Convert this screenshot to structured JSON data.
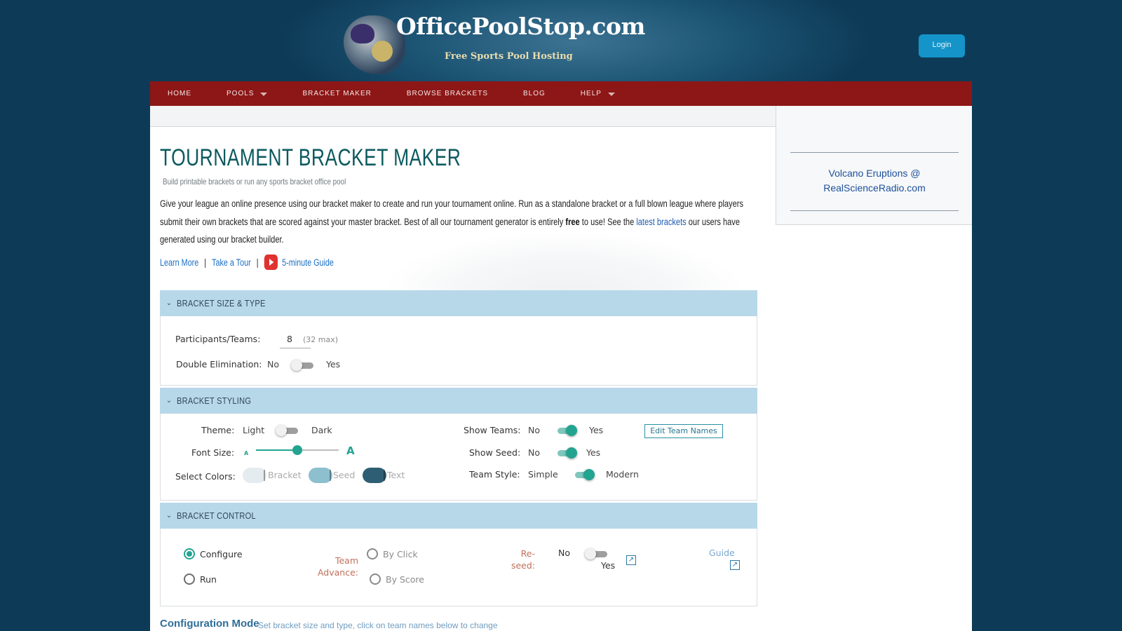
{
  "header": {
    "logo_title": "OfficePoolStop.com",
    "logo_tagline": "Free Sports Pool Hosting",
    "login_label": "Login"
  },
  "nav": {
    "items": [
      {
        "label": "HOME",
        "dropdown": false
      },
      {
        "label": "POOLS",
        "dropdown": true
      },
      {
        "label": "BRACKET MAKER",
        "dropdown": false
      },
      {
        "label": "BROWSE BRACKETS",
        "dropdown": false
      },
      {
        "label": "BLOG",
        "dropdown": false
      },
      {
        "label": "HELP",
        "dropdown": true
      }
    ]
  },
  "page": {
    "title": "TOURNAMENT BRACKET MAKER",
    "subtitle": "Build printable brackets or run any sports bracket office pool",
    "intro_part1": "Give your league an online presence using our bracket maker to create and run your tournament online. Run as a standalone bracket or a full blown league where players submit their own brackets that are scored against your master bracket. Best of all our tournament generator is entirely ",
    "intro_bold": "free",
    "intro_part2": " to use! See the ",
    "intro_link": "latest brackets",
    "intro_part3": " our users have generated using our bracket builder.",
    "link_learn_more": "Learn More",
    "link_take_tour": "Take a Tour",
    "link_guide": "5-minute Guide",
    "link_separator": "|"
  },
  "sidebar": {
    "link_line1": "Volcano Eruptions @",
    "link_line2": "RealScienceRadio.com"
  },
  "panel_size": {
    "title": "BRACKET SIZE & TYPE",
    "participants_label": "Participants/Teams:",
    "participants_value": "8",
    "participants_hint": "(32 max)",
    "double_elim_label": "Double Elimination:",
    "double_elim_no": "No",
    "double_elim_yes": "Yes",
    "double_elim_on": false
  },
  "panel_styling": {
    "title": "BRACKET STYLING",
    "theme_label": "Theme:",
    "theme_light": "Light",
    "theme_dark": "Dark",
    "theme_dark_on": false,
    "font_size_label": "Font Size:",
    "font_small": "A",
    "font_large": "A",
    "font_size_fraction": 0.5,
    "colors_label": "Select Colors:",
    "color_bracket_label": "Bracket",
    "color_seed_label": "Seed",
    "color_text_label": "Text",
    "color_bracket": "#e5ecef",
    "color_seed": "#8dbfcf",
    "color_text": "#2e5e73",
    "show_teams_label": "Show Teams:",
    "show_teams_no": "No",
    "show_teams_yes": "Yes",
    "show_teams_on": true,
    "edit_team_names": "Edit Team Names",
    "show_seed_label": "Show Seed:",
    "show_seed_no": "No",
    "show_seed_yes": "Yes",
    "show_seed_on": true,
    "team_style_label": "Team Style:",
    "team_style_simple": "Simple",
    "team_style_modern": "Modern",
    "team_style_modern_on": true
  },
  "panel_control": {
    "title": "BRACKET CONTROL",
    "mode_configure": "Configure",
    "mode_run": "Run",
    "mode_selected": "Configure",
    "team_advance_line1": "Team",
    "team_advance_line2": "Advance:",
    "advance_by_click": "By Click",
    "advance_by_score": "By Score",
    "reseed_line1": "Re-",
    "reseed_line2": "seed:",
    "reseed_no": "No",
    "reseed_yes": "Yes",
    "reseed_on": false,
    "guide_label": "Guide"
  },
  "config_mode": {
    "title": "Configuration Mode",
    "description": "Set bracket size and type, click on team names below to change"
  },
  "colors": {
    "background": "#0d3b57",
    "nav_bar": "#8c1716",
    "panel_header": "#b7d8e9",
    "accent": "#23a491",
    "login_button": "#1494c8"
  }
}
